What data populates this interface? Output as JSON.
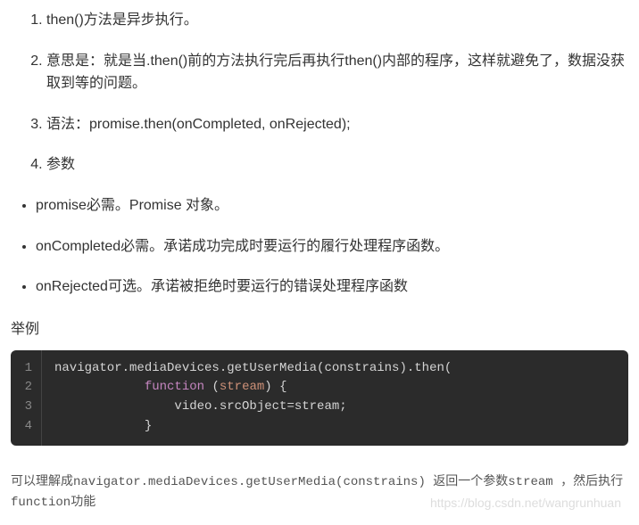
{
  "ordered": [
    "then()方法是异步执行。",
    "意思是：就是当.then()前的方法执行完后再执行then()内部的程序，这样就避免了，数据没获取到等的问题。",
    "语法：promise.then(onCompleted, onRejected);",
    "参数"
  ],
  "bullets": [
    "promise必需。Promise 对象。",
    "onCompleted必需。承诺成功完成时要运行的履行处理程序函数。",
    "onRejected可选。承诺被拒绝时要运行的错误处理程序函数"
  ],
  "example_label": "举例",
  "code": {
    "line1": {
      "a": "navigator.mediaDevices.getUserMedia(constrains).then("
    },
    "line2": {
      "indent": "            ",
      "kw": "function",
      "mid": " (",
      "param": "stream",
      "end": ") {"
    },
    "line3": {
      "indent": "                ",
      "text": "video.srcObject=stream;"
    },
    "line4": {
      "indent": "            ",
      "text": "}"
    },
    "ln1": "1",
    "ln2": "2",
    "ln3": "3",
    "ln4": "4"
  },
  "footer": {
    "line1": "可以理解成navigator.mediaDevices.getUserMedia(constrains) 返回一个参数stream ，然后执行",
    "line2": "function功能"
  },
  "watermark": "https://blog.csdn.net/wangrunhuan"
}
